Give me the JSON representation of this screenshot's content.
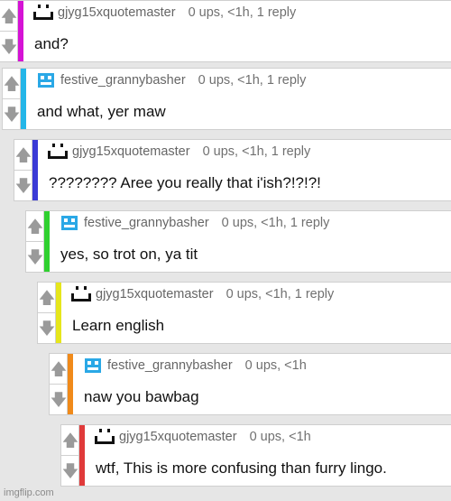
{
  "comments": [
    {
      "user": "gjyg15xquotemaster",
      "avatar": "smiley-face-icon",
      "meta": "0 ups, <1h, 1 reply",
      "text": "and?",
      "color": "#d513d5"
    },
    {
      "user": "festive_grannybasher",
      "avatar": "meme-face-icon",
      "meta": "0 ups, <1h, 1 reply",
      "text": "and what, yer maw",
      "color": "#24b6e8"
    },
    {
      "user": "gjyg15xquotemaster",
      "avatar": "smiley-face-icon",
      "meta": "0 ups, <1h, 1 reply",
      "text": "???????? Aree you really that i'ish?!?!?!",
      "color": "#3b3bd6"
    },
    {
      "user": "festive_grannybasher",
      "avatar": "meme-face-icon",
      "meta": "0 ups, <1h, 1 reply",
      "text": "yes, so trot on, ya tit",
      "color": "#2fd02f"
    },
    {
      "user": "gjyg15xquotemaster",
      "avatar": "smiley-face-icon",
      "meta": "0 ups, <1h, 1 reply",
      "text": "Learn english",
      "color": "#e6e61c"
    },
    {
      "user": "festive_grannybasher",
      "avatar": "meme-face-icon",
      "meta": "0 ups, <1h",
      "text": "naw you bawbag",
      "color": "#f08a1a"
    },
    {
      "user": "gjyg15xquotemaster",
      "avatar": "smiley-face-icon",
      "meta": "0 ups, <1h",
      "text": "wtf, This is more confusing than furry lingo.",
      "color": "#e03a3a"
    }
  ],
  "vote_up_glyph": "🡅",
  "vote_down_glyph": "🡇",
  "watermark": "imgflip.com"
}
